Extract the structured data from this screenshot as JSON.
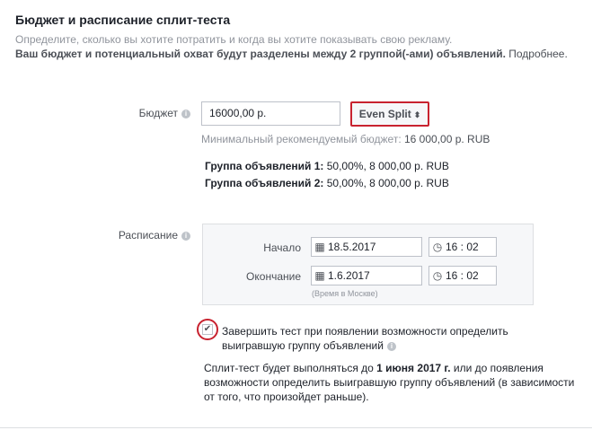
{
  "header": {
    "title": "Бюджет и расписание сплит-теста",
    "subtitle": "Определите, сколько вы хотите потратить и когда вы хотите показывать свою рекламу.",
    "split_bold": "Ваш бюджет и потенциальный охват будут разделены между 2 группой(-ами) объявлений.",
    "more_link": "Подробнее."
  },
  "budget": {
    "label": "Бюджет",
    "value": "16000,00 р.",
    "split_label": "Even Split",
    "min_prefix": "Минимальный рекомендуемый бюджет:",
    "min_value": "16 000,00 р. RUB",
    "groups": [
      {
        "name": "Группа объявлений 1:",
        "detail": "50,00%, 8 000,00 р. RUB"
      },
      {
        "name": "Группа объявлений 2:",
        "detail": "50,00%, 8 000,00 р. RUB"
      }
    ]
  },
  "schedule": {
    "label": "Расписание",
    "start_label": "Начало",
    "start_date": "18.5.2017",
    "start_time": "16 : 02",
    "end_label": "Окончание",
    "end_date": "1.6.2017",
    "end_time": "16 : 02",
    "timezone_note": "(Время в Москве)"
  },
  "finish_test": {
    "checked": true,
    "label": "Завершить тест при появлении возможности определить выигравшую группу объявлений"
  },
  "note": {
    "p1": "Сплит-тест будет выполняться до ",
    "bold": "1 июня 2017 г.",
    "p2": " или до появления возможности определить выигравшую группу объявлений (в зависимости от того, что произойдет раньше)."
  },
  "colors": {
    "highlight": "#c8222f",
    "muted": "#90949c",
    "border": "#bdc1c9"
  }
}
